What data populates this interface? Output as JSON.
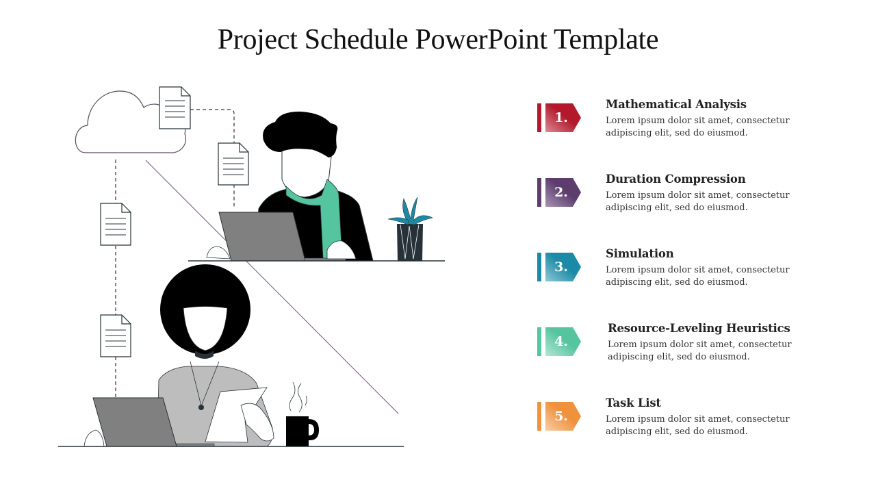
{
  "slide": {
    "title": "Project Schedule PowerPoint Template"
  },
  "steps": [
    {
      "number": "1.",
      "title": "Mathematical Analysis",
      "description": "Lorem ipsum dolor sit amet, consectetur adipiscing elit, sed do eiusmod.",
      "color": "#b3192b",
      "color_light": "#d98a93"
    },
    {
      "number": "2.",
      "title": "Duration Compression",
      "description": "Lorem ipsum dolor sit amet, consectetur adipiscing elit, sed do eiusmod.",
      "color": "#5c3d6e",
      "color_light": "#a995b3"
    },
    {
      "number": "3.",
      "title": "Simulation",
      "description": "Lorem ipsum dolor sit amet, consectetur adipiscing elit, sed do eiusmod.",
      "color": "#1a8aa6",
      "color_light": "#8fc8d6"
    },
    {
      "number": "4.",
      "title": "Resource-Leveling Heuristics",
      "description": "Lorem ipsum dolor sit amet, consectetur adipiscing elit, sed do eiusmod.",
      "color": "#55c5a0",
      "color_light": "#b5e6d6"
    },
    {
      "number": "5.",
      "title": "Task List",
      "description": "Lorem ipsum dolor sit amet, consectetur adipiscing elit, sed do eiusmod.",
      "color": "#f0923d",
      "color_light": "#f8cda4"
    }
  ],
  "illustration": {
    "scarf_color": "#55c5a0",
    "plant_color": "#1a8aa6",
    "pot_color": "#263238",
    "laptop_color": "#808080",
    "shirt_color": "#bdbdbd"
  }
}
